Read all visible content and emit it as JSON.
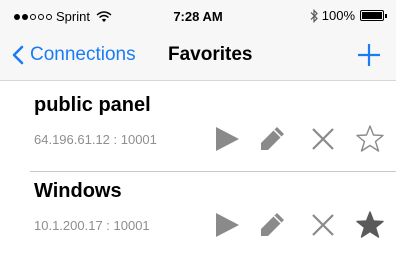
{
  "status_bar": {
    "carrier": "Sprint",
    "signal_bars_filled": 2,
    "signal_bars_total": 5,
    "time": "7:28 AM",
    "battery": "100%",
    "icons": [
      "wifi-icon",
      "bluetooth-icon",
      "battery-icon"
    ]
  },
  "nav": {
    "back_label": "Connections",
    "title": "Favorites",
    "add_icon": "plus-icon",
    "back_icon": "chevron-left-icon"
  },
  "connections": [
    {
      "name": "public panel",
      "address": "64.196.61.12 : 10001",
      "favorite": false
    },
    {
      "name": "Windows",
      "address": "10.1.200.17 : 10001",
      "favorite": true
    }
  ],
  "row_actions": [
    "play-icon",
    "pencil-icon",
    "close-icon",
    "star-icon"
  ],
  "colors": {
    "accent": "#1a7cf5",
    "icon_gray": "#8a8a8a",
    "favorite_star": "#5a5a5a",
    "bar_background": "#f7f7f8",
    "secondary_text": "#8e8e93"
  }
}
